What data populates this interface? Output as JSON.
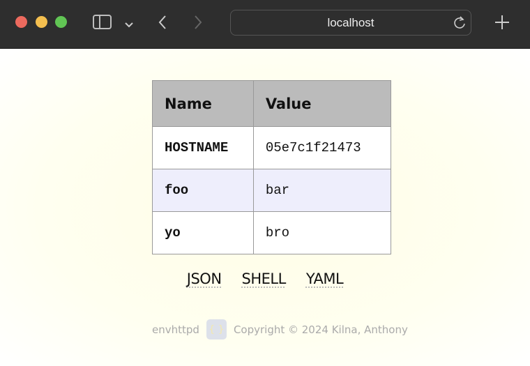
{
  "browser": {
    "url": "localhost",
    "colors": {
      "close": "#ec6a5e",
      "minimize": "#f4bf4f",
      "zoom": "#61c554"
    }
  },
  "table": {
    "headers": [
      "Name",
      "Value"
    ],
    "rows": [
      {
        "name": "HOSTNAME",
        "value": "05e7c1f21473"
      },
      {
        "name": "foo",
        "value": "bar"
      },
      {
        "name": "yo",
        "value": "bro"
      }
    ]
  },
  "links": [
    "JSON",
    "SHELL",
    "YAML"
  ],
  "footer": {
    "app": "envhttpd",
    "logo": "{ }",
    "copyright": "Copyright © 2024 Kilna, Anthony"
  }
}
